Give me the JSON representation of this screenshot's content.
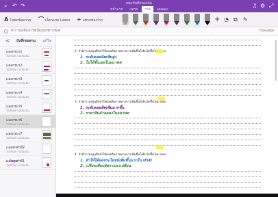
{
  "window": {
    "notebook_title": "สมุดบันทึกของฉัน",
    "tabs": [
      {
        "label": "หน้าแรก",
        "active": false
      },
      {
        "label": "แทรก",
        "active": false
      },
      {
        "label": "วาด",
        "active": true
      },
      {
        "label": "มุมมอง",
        "active": false
      }
    ]
  },
  "ribbon": {
    "text_tool": "โหมดข้อความ",
    "lasso_tool": "เลือกแบบ Lasso",
    "space_tool": "แทรกช่องว่าง",
    "pen_colors": [
      "#9a9a9a",
      "#2e7d32",
      "#c62828",
      "#6a1b9a",
      "#ad1457",
      "#4e342e",
      "#2e7d32",
      "#1565c0",
      "#000000"
    ]
  },
  "info_bar": {
    "message": "ทำการลงชื่อเข้าใช้เพื่อเปิดใช้การซิงค์",
    "right_label": "รายละเอียด"
  },
  "sidebar": {
    "back": "<",
    "title": "บันทึกย่อสาม",
    "edit": "แก้ไข",
    "pages": [
      {
        "title": "เเอลกรมา1",
        "subtitle": "ไม่มีข้อความเพิ่มเติม",
        "selected": false
      },
      {
        "title": "เเอลกรมา2",
        "subtitle": "ไม่มีข้อความเพิ่มเติม",
        "selected": false
      },
      {
        "title": "เเอลกรมา3",
        "subtitle": "ไม่มีข้อความเพิ่มเติม",
        "selected": false
      },
      {
        "title": "เเอลกรมา4",
        "subtitle": "ไม่มีข้อความเพิ่มเติม",
        "selected": false
      },
      {
        "title": "เเอลกรมา5",
        "subtitle": "ไม่มีข้อความเพิ่มเติม",
        "selected": false
      },
      {
        "title": "เเอลกรมา6",
        "subtitle": "ไม่มีข้อความเพิ่มเติม",
        "selected": true
      },
      {
        "title": "เเอลกรมา7",
        "subtitle": "ไม่มีข้อความเพิ่มเติม",
        "selected": false
      },
      {
        "title": "เเอลสกคำที่2",
        "subtitle": "ไม่มีข้อความเพิ่มเติม",
        "selected": false
      },
      {
        "title": "เเอลสกคำที่1",
        "subtitle": "ไม่มีข้อความเพิ่มเติม",
        "selected": false
      }
    ],
    "add_page": "+ Page"
  },
  "content": {
    "q2": "2. ถ้ามีการลงทุนฝึกทำให้ผลผลิตภาพทางการเพิ่มขึ้นก็เติบโตขึ้นไหม ตอบ",
    "q2_ans1": "1. ระดับผลผลิตเพิ่มสูง",
    "q2_ans2": "2. ไม่ได้ขึ้นเลยในอนาคต",
    "q3": "3. ถ้ามีการลงทุนฝึกทำให้ผลผลิตภาพทางการเพิ่มขึ้นก็เติบโตขึ้นไหม ตอบ",
    "q3_ans1": "1. ระดับผลผลิตเพิ่มมากขึ้น",
    "q3_ans2": "2. ราคาสินค้าลดลงในอนาคต",
    "q4": "4. ถ้ามีการลงทุนฝึกทำให้ผลผลิตภาพทางการเพิ่มขึ้นก็เติบโตขึ้นไหม ตอบ",
    "q4_ans1": "1. ทำให้ได้ผลประโยชน์เพิ่มขึ้นมากใน USD",
    "q4_ans2": "2. เปรียบเทียบอัตราแลกเปลี่ยน"
  }
}
